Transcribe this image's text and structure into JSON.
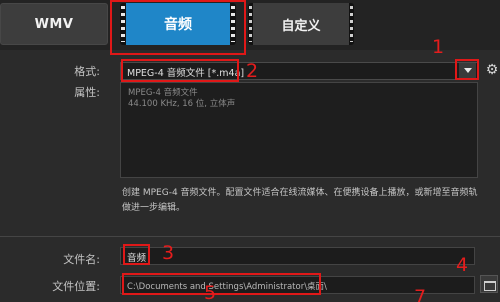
{
  "tabs": [
    {
      "label": "WMV"
    },
    {
      "label": "音频",
      "selected": true
    },
    {
      "label": "自定义"
    }
  ],
  "format": {
    "label": "格式:",
    "value": "MPEG-4 音频文件 [*.m4a]",
    "dropdown_icon": "chevron-down-icon",
    "settings_icon": "gear-icon"
  },
  "properties": {
    "label": "属性:",
    "lines": [
      "MPEG-4 音频文件",
      "44.100 KHz, 16 位, 立体声"
    ]
  },
  "description": "创建 MPEG-4 音频文件。配置文件适合在线流媒体、在便携设备上播放，或新增至音频轨做进一步编辑。",
  "filename": {
    "label": "文件名:",
    "value": "音频"
  },
  "location": {
    "label": "文件位置:",
    "value": "C:\\Documents and Settings\\Administrator\\桌面\\",
    "browse_icon": "folder-icon"
  },
  "annotations": [
    "1",
    "2",
    "3",
    "4",
    "5",
    "7"
  ],
  "colors": {
    "selected_tab": "#1f86c8",
    "annotation": "#e01818",
    "background": "#2b2b2b"
  }
}
